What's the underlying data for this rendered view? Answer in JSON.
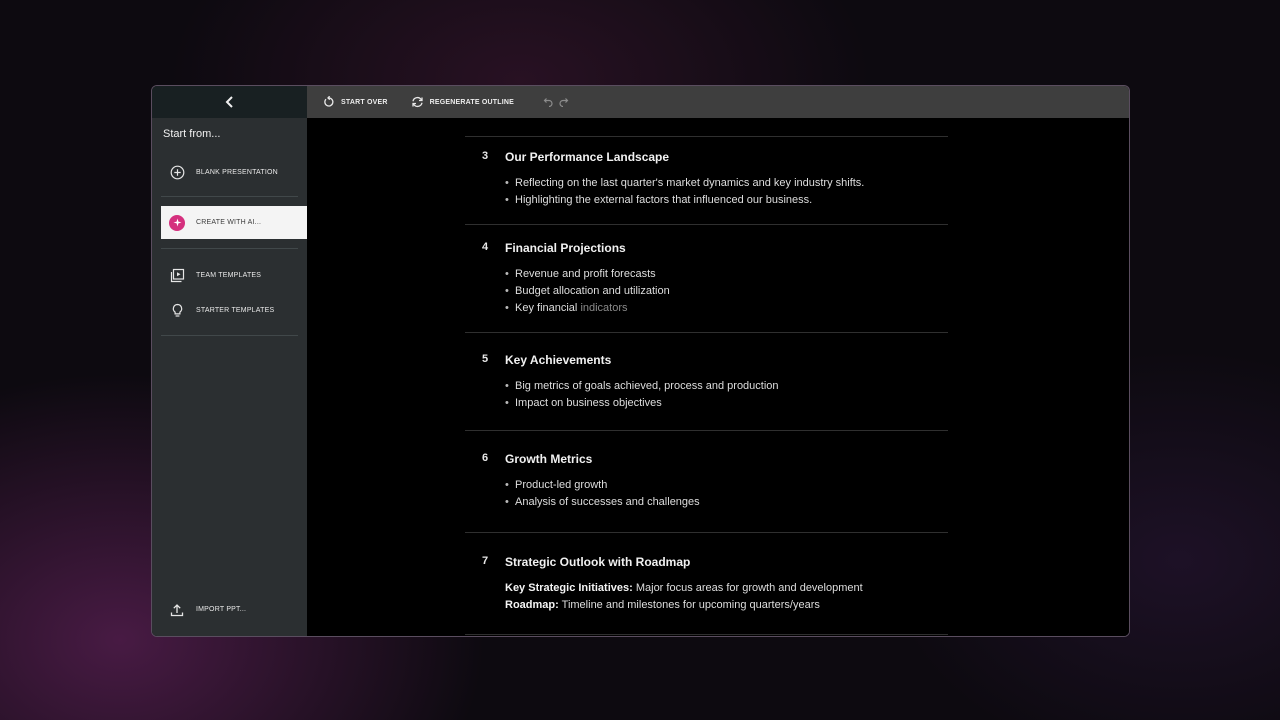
{
  "sidebar": {
    "heading": "Start from...",
    "items": [
      {
        "label": "BLANK PRESENTATION",
        "icon": "plus-circle-icon"
      },
      {
        "label": "CREATE WITH AI...",
        "icon": "ai-sparkle-icon"
      },
      {
        "label": "TEAM TEMPLATES",
        "icon": "team-templates-icon"
      },
      {
        "label": "STARTER TEMPLATES",
        "icon": "lightbulb-icon"
      }
    ],
    "import_label": "IMPORT PPT..."
  },
  "toolbar": {
    "start_over": "START OVER",
    "regenerate": "REGENERATE OUTLINE"
  },
  "outline": [
    {
      "num": "3",
      "title": "Our Performance Landscape",
      "bullets": [
        "Reflecting on the last quarter's market dynamics and key industry shifts.",
        "Highlighting the external factors that influenced our business."
      ]
    },
    {
      "num": "4",
      "title": "Financial Projections",
      "bullets": [
        "Revenue and profit forecasts",
        "Budget allocation and utilization",
        "Key financial"
      ],
      "bullet3_faded": "indicators"
    },
    {
      "num": "5",
      "title": "Key Achievements",
      "bullets": [
        "Big metrics of goals achieved, process and production",
        "Impact on business objectives"
      ]
    },
    {
      "num": "6",
      "title": "Growth Metrics",
      "bullets": [
        "Product-led growth",
        "Analysis of successes and challenges"
      ]
    },
    {
      "num": "7",
      "title": "Strategic Outlook with Roadmap",
      "lines": [
        {
          "key": "Key Strategic Initiatives:",
          "text": "Major focus areas for growth and development"
        },
        {
          "key": "Roadmap:",
          "text": "Timeline and milestones for upcoming quarters/years"
        }
      ]
    }
  ],
  "colors": {
    "accent": "#d5307e",
    "sidebar": "#2b2f31",
    "toolbar": "#3e3e3e"
  }
}
